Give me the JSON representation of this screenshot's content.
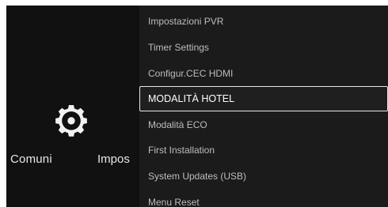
{
  "left": {
    "icon": "gear-icon",
    "label_comuni": "Comuni",
    "label_impos": "Impos"
  },
  "menu": {
    "items": [
      {
        "label": "Impostazioni PVR"
      },
      {
        "label": "Timer Settings"
      },
      {
        "label": "Configur.CEC HDMI"
      },
      {
        "label": "MODALITÀ HOTEL"
      },
      {
        "label": "Modalità ECO"
      },
      {
        "label": "First Installation"
      },
      {
        "label": "System Updates (USB)"
      },
      {
        "label": "Menu Reset"
      }
    ],
    "selected_index": 3
  },
  "colors": {
    "background": "#111111",
    "menu_background": "#1b1b1b",
    "text": "#bdbdbd",
    "selected_text": "#ffffff",
    "selected_border": "#e8e8e8"
  }
}
